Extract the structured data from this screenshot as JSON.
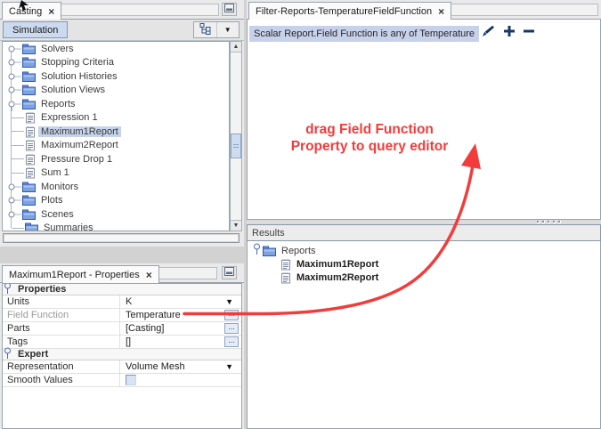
{
  "glyphs": {
    "close": "×",
    "dropdown": "▼",
    "scroll_up": "▲",
    "scroll_down": "▼",
    "ellipsis": "..."
  },
  "colors": {
    "accent_red": "#f43b3b",
    "selection": "#c6d4ea",
    "query_highlight": "#c7d1e9",
    "icon_navy": "#1c3a6e"
  },
  "left_top": {
    "tab": {
      "title": "Casting"
    },
    "toolbar": {
      "simulation_label": "Simulation"
    },
    "tree": [
      {
        "label": "Solvers",
        "type": "folder",
        "depth": 0,
        "handle": "collapsed"
      },
      {
        "label": "Stopping Criteria",
        "type": "folder",
        "depth": 0,
        "handle": "collapsed"
      },
      {
        "label": "Solution Histories",
        "type": "folder",
        "depth": 0,
        "handle": "collapsed"
      },
      {
        "label": "Solution Views",
        "type": "folder",
        "depth": 0,
        "handle": "collapsed"
      },
      {
        "label": "Reports",
        "type": "folder",
        "depth": 0,
        "handle": "expanded"
      },
      {
        "label": "Expression 1",
        "type": "report",
        "depth": 1
      },
      {
        "label": "Maximum1Report",
        "type": "report",
        "depth": 1,
        "selected": true
      },
      {
        "label": "Maximum2Report",
        "type": "report",
        "depth": 1
      },
      {
        "label": "Pressure Drop 1",
        "type": "report",
        "depth": 1
      },
      {
        "label": "Sum 1",
        "type": "report",
        "depth": 1
      },
      {
        "label": "Monitors",
        "type": "folder",
        "depth": 0,
        "handle": "collapsed"
      },
      {
        "label": "Plots",
        "type": "folder",
        "depth": 0,
        "handle": "collapsed"
      },
      {
        "label": "Scenes",
        "type": "folder",
        "depth": 0,
        "handle": "collapsed"
      },
      {
        "label": "Summaries",
        "type": "folder",
        "depth": 0,
        "handle": "stub"
      }
    ]
  },
  "left_bottom": {
    "tab": {
      "title": "Maximum1Report - Properties"
    },
    "sections": [
      {
        "title": "Properties",
        "rows": [
          {
            "label": "Units",
            "value": "K",
            "control": "dropdown"
          },
          {
            "label": "Field Function",
            "value": "Temperature",
            "control": "ellipsis",
            "muted": true
          },
          {
            "label": "Parts",
            "value": "[Casting]",
            "control": "ellipsis"
          },
          {
            "label": "Tags",
            "value": "[]",
            "control": "ellipsis"
          }
        ]
      },
      {
        "title": "Expert",
        "rows": [
          {
            "label": "Representation",
            "value": "Volume Mesh",
            "control": "dropdown"
          },
          {
            "label": "Smooth Values",
            "value": "",
            "control": "checkbox"
          }
        ]
      }
    ]
  },
  "right": {
    "tab": {
      "title": "Filter-Reports-TemperatureFieldFunction"
    },
    "query": {
      "text": "Scalar Report.Field Function is any of Temperature"
    },
    "results": {
      "header": "Results",
      "tree": [
        {
          "label": "Reports",
          "type": "folder",
          "depth": 0,
          "handle": "expanded"
        },
        {
          "label": "Maximum1Report",
          "type": "report",
          "depth": 1,
          "bold": true
        },
        {
          "label": "Maximum2Report",
          "type": "report",
          "depth": 1,
          "bold": true
        }
      ]
    }
  },
  "annotation": {
    "line1": "drag Field Function",
    "line2": "Property to query editor"
  }
}
